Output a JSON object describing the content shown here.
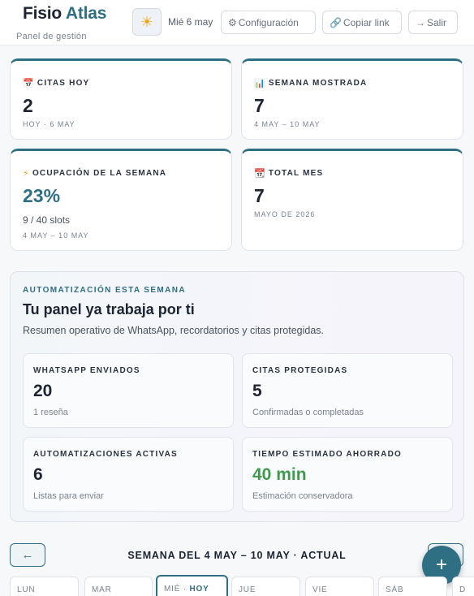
{
  "header": {
    "brand_main": "Fisio",
    "brand_accent": "Atlas",
    "subtitle": "Panel de gestión",
    "date": "Mié 6 may",
    "config_label": "Configuración",
    "link_label": "Copiar link",
    "logout_label": "Salir"
  },
  "stats": [
    {
      "label": "CITAS HOY",
      "value": "2",
      "sub": "HOY · 6 MAY",
      "icon": "calendar-icon"
    },
    {
      "label": "SEMANA MOSTRADA",
      "value": "7",
      "sub": "4 MAY – 10 MAY",
      "icon": "bar-chart-icon"
    },
    {
      "label": "OCUPACIÓN DE LA SEMANA",
      "value": "23%",
      "detail": "9 / 40 slots",
      "sub": "4 MAY – 10 MAY",
      "icon": "lightning-icon"
    },
    {
      "label": "TOTAL MES",
      "value": "7",
      "sub": "MAYO DE 2026",
      "icon": "calendar-month-icon"
    }
  ],
  "automation": {
    "eyebrow": "AUTOMATIZACIÓN ESTA SEMANA",
    "title": "Tu panel ya trabaja por ti",
    "description": "Resumen operativo de WhatsApp, recordatorios y citas protegidas.",
    "cards": [
      {
        "label": "WHATSAPP ENVIADOS",
        "value": "20",
        "sub": "1 reseña"
      },
      {
        "label": "CITAS PROTEGIDAS",
        "value": "5",
        "sub": "Confirmadas o completadas"
      },
      {
        "label": "AUTOMATIZACIONES ACTIVAS",
        "value": "6",
        "sub": "Listas para enviar"
      },
      {
        "label": "TIEMPO ESTIMADO AHORRADO",
        "value": "40 min",
        "sub": "Estimación conservadora"
      }
    ]
  },
  "week": {
    "label": "SEMANA DEL 4 MAY – 10 MAY · ACTUAL",
    "prev_icon": "arrow-left-icon",
    "add_icon": "plus-icon",
    "days": [
      {
        "label": "LUN"
      },
      {
        "label": "MAR"
      },
      {
        "label": "MIÉ",
        "today": "HOY"
      },
      {
        "label": "JUE"
      },
      {
        "label": "VIE"
      },
      {
        "label": "SÁB"
      },
      {
        "label": "D"
      }
    ]
  },
  "colors": {
    "accent": "#2f6f84",
    "success": "#3f9a4e",
    "text": "#1c2433"
  }
}
